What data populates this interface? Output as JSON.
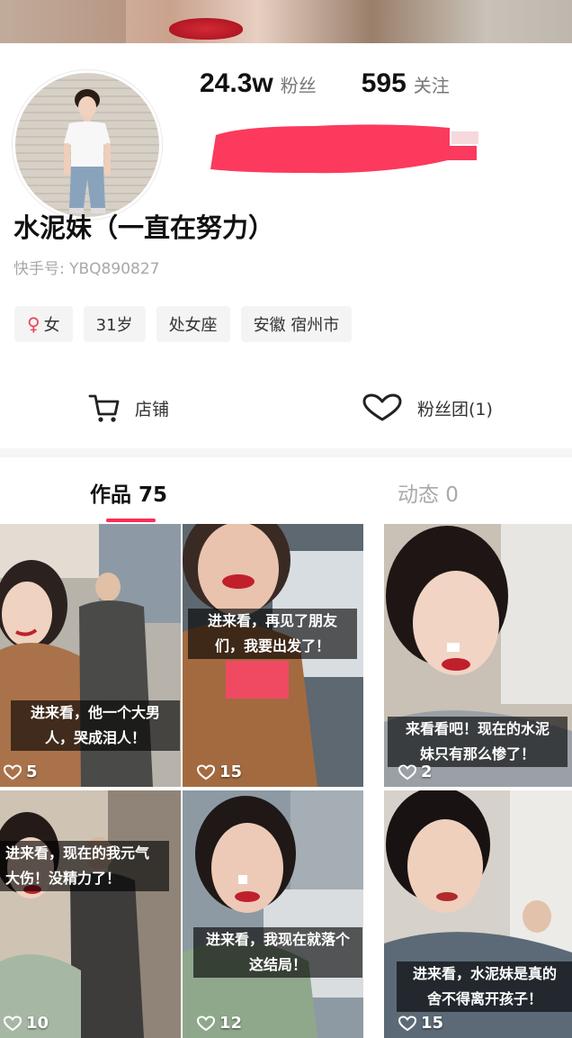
{
  "profile": {
    "followers_value": "24.3w",
    "followers_label": "粉丝",
    "following_value": "595",
    "following_label": "关注",
    "nickname": "水泥妹（一直在努力）",
    "kuaishou_id": "快手号: YBQ890827"
  },
  "tags": [
    {
      "icon": "female-symbol-icon",
      "label": "女"
    },
    {
      "label": "31岁"
    },
    {
      "label": "处女座"
    },
    {
      "label": "安徽 宿州市"
    }
  ],
  "actions": {
    "shop_label": "店铺",
    "fan_group_label": "粉丝团(1)"
  },
  "tabs": [
    {
      "label": "作品 75",
      "active": true
    },
    {
      "label": "动态 0",
      "active": false
    }
  ],
  "videos": [
    {
      "caption_lines": [
        "进来看，他一个大男",
        "人，哭成泪人！"
      ],
      "likes": "5"
    },
    {
      "caption_lines": [
        "进来看，再见了朋友",
        "们，我要出发了！"
      ],
      "likes": "15"
    },
    {
      "caption_lines": [
        "来看看吧！现在的水泥",
        "妹只有那么惨了！"
      ],
      "likes": "2"
    },
    {
      "caption_lines": [
        "进来看，现在的我元气",
        "大伤！没精力了！"
      ],
      "likes": "10"
    },
    {
      "caption_lines": [
        "进来看，我现在就落个",
        "这结局！"
      ],
      "likes": "12"
    },
    {
      "caption_lines": [
        "进来看，水泥妹是真的",
        "舍不得离开孩子！"
      ],
      "likes": "15"
    }
  ],
  "colors": {
    "accent": "#fe2c55",
    "redaction": "#fb3a5e"
  }
}
